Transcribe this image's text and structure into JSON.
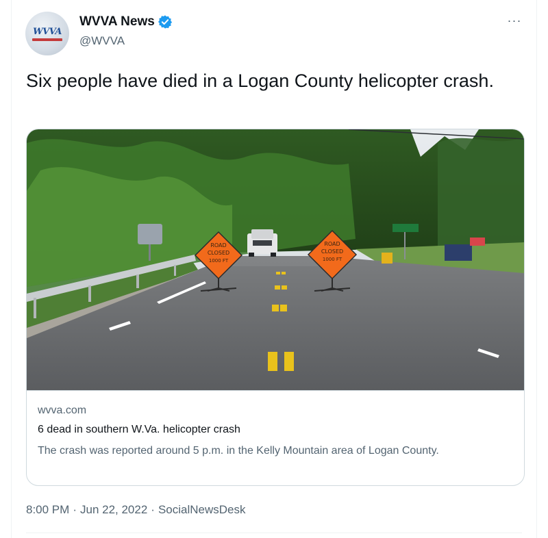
{
  "author": {
    "display_name": "WVVA News",
    "handle": "@WVVA",
    "avatar_text": "WVVA",
    "verified_color": "#1d9bf0"
  },
  "tweet": {
    "text": "Six people have died in a Logan County helicopter crash."
  },
  "card": {
    "domain": "wvva.com",
    "title": "6 dead in southern W.Va. helicopter crash",
    "description": "The crash was reported around 5 p.m. in the Kelly Mountain area of Logan County.",
    "image": {
      "sign_lines": [
        "ROAD",
        "CLOSED",
        "1000 FT"
      ],
      "sign_color": "#f26a1b"
    }
  },
  "meta": {
    "time": "8:00 PM",
    "date": "Jun 22, 2022",
    "source": "SocialNewsDesk",
    "separator": "·"
  },
  "icons": {
    "more": "more-icon",
    "verified": "verified-badge-icon"
  }
}
